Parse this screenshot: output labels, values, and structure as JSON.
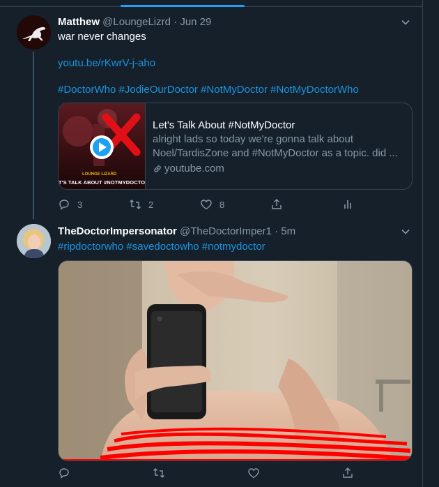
{
  "tweets": [
    {
      "author_name": "Matthew",
      "handle": "@LoungeLizrd",
      "separator": "·",
      "time": "Jun 29",
      "text_line1": "war never changes",
      "link": "youtu.be/rKwrV-j-aho",
      "hashtags": "#DoctorWho #JodieOurDoctor #NotMyDoctor #NotMyDoctorWho",
      "card": {
        "thumb_title": "LOUNGE LIZARD",
        "thumb_subtitle": "T'S TALK ABOUT #NOTMYDOCTO",
        "title": "Let's Talk About #NotMyDoctor",
        "description": "alright lads so today we're gonna talk about Noel/TardisZone and #NotMyDoctor as a topic. did ...",
        "domain": "youtube.com"
      },
      "actions": {
        "replies": "3",
        "retweets": "2",
        "likes": "8"
      }
    },
    {
      "author_name": "TheDoctorImpersonator",
      "handle": "@TheDoctorImper1",
      "separator": "·",
      "time": "5m",
      "hashtags": "#ripdoctorwho #savedoctowho #notmydoctor",
      "actions": {
        "replies": "",
        "retweets": "",
        "likes": ""
      }
    }
  ],
  "colors": {
    "background": "#15202b",
    "border": "#38444d",
    "accent": "#1b95e0",
    "muted": "#8899a6",
    "redaction": "#ff0000"
  },
  "icons": [
    "caret-down-icon",
    "reply-icon",
    "retweet-icon",
    "like-icon",
    "share-icon",
    "analytics-icon",
    "link-icon",
    "play-icon"
  ]
}
